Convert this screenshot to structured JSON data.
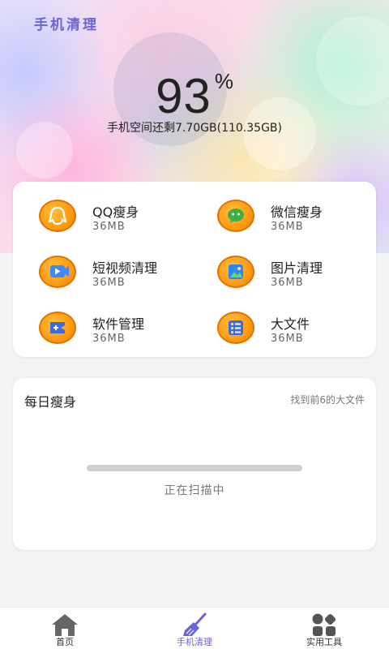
{
  "header": {
    "app_title": "手机清理",
    "percent": "93",
    "percent_sign": "%",
    "space_text": "手机空间还剩7.70GB(110.35GB)"
  },
  "tools": [
    {
      "name": "QQ瘦身",
      "size": "36MB",
      "icon": "qq-icon"
    },
    {
      "name": "微信瘦身",
      "size": "36MB",
      "icon": "wechat-icon"
    },
    {
      "name": "短视频清理",
      "size": "36MB",
      "icon": "video-icon"
    },
    {
      "name": "图片清理",
      "size": "36MB",
      "icon": "image-icon"
    },
    {
      "name": "软件管理",
      "size": "36MB",
      "icon": "gamepad-icon"
    },
    {
      "name": "大文件",
      "size": "36MB",
      "icon": "file-list-icon"
    }
  ],
  "daily": {
    "title": "每日瘦身",
    "subtitle": "找到前6的大文件",
    "status": "正在扫描中",
    "progress": 1.0
  },
  "tabbar": {
    "items": [
      {
        "label": "首页",
        "icon": "home-icon",
        "active": false
      },
      {
        "label": "手机清理",
        "icon": "broom-icon",
        "active": true
      },
      {
        "label": "实用工具",
        "icon": "tools-grid-icon",
        "active": false
      }
    ]
  },
  "colors": {
    "accent": "#6a64d8",
    "tool_orange": "#ff9b13",
    "background": "#f3f3f5"
  }
}
